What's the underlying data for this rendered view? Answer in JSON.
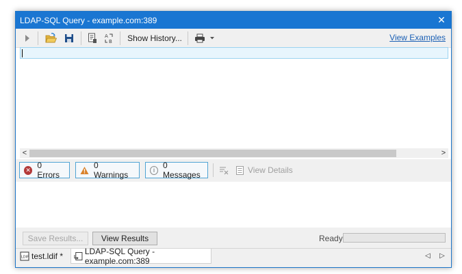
{
  "window": {
    "title": "LDAP-SQL Query - example.com:389",
    "close_glyph": "✕"
  },
  "toolbar": {
    "show_history_label": "Show History...",
    "view_examples_label": "View Examples"
  },
  "messages": {
    "errors_label": "0 Errors",
    "warnings_label": "0 Warnings",
    "messages_label": "0 Messages",
    "view_details_label": "View Details"
  },
  "bottom": {
    "save_results_label": "Save Results...",
    "view_results_label": "View Results",
    "status_text": "Ready"
  },
  "tabs": [
    {
      "label": "test.ldif *"
    },
    {
      "label": "LDAP-SQL Query - example.com:389"
    }
  ],
  "colors": {
    "accent": "#1a76d2",
    "error": "#b33a3a",
    "warning": "#d9822b",
    "chip_border": "#4fa3d4"
  }
}
